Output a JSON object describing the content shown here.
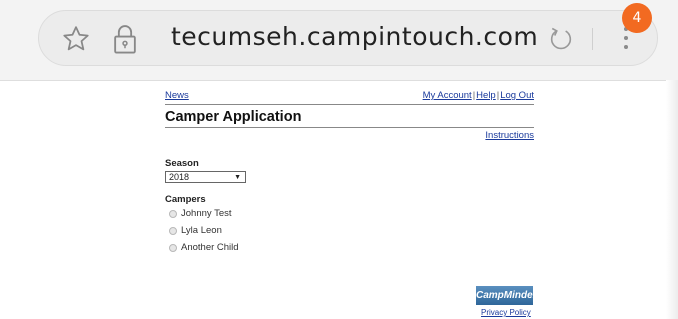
{
  "browser": {
    "url": "tecumseh.campintouch.com",
    "tab_badge": "4",
    "accent": "#f26a21"
  },
  "page": {
    "nav": {
      "news": "News",
      "my_account": "My Account",
      "help": "Help",
      "log_out": "Log Out",
      "separator": "|"
    },
    "title": "Camper Application",
    "instructions": "Instructions",
    "season": {
      "label": "Season",
      "selected": "2018"
    },
    "campers": {
      "label": "Campers",
      "items": [
        "Johnny Test",
        "Lyla Leon",
        "Another Child"
      ]
    },
    "footer": {
      "logo_text": "CampMinder",
      "privacy": "Privacy Policy"
    },
    "link_color": "#1a3a9c"
  }
}
